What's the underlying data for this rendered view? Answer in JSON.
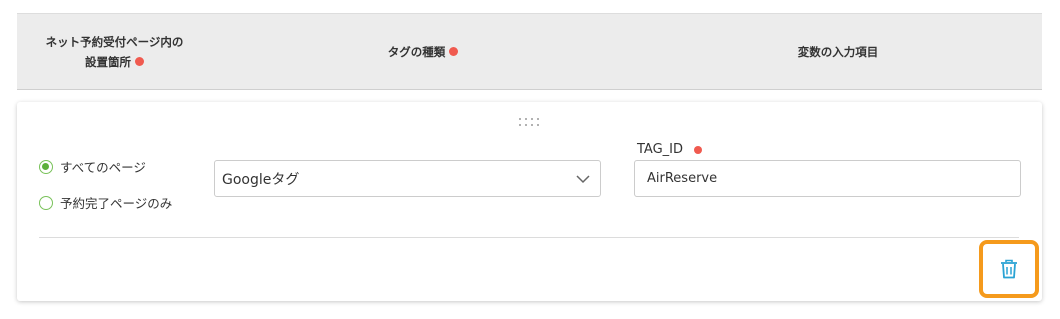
{
  "table_header": {
    "col1_line1": "ネット予約受付ページ内の",
    "col1_line2": "設置箇所",
    "col2": "タグの種類",
    "col3": "変数の入力項目"
  },
  "row": {
    "placement_options": [
      {
        "label": "すべてのページ",
        "checked": true
      },
      {
        "label": "予約完了ページのみ",
        "checked": false
      }
    ],
    "tag_type": {
      "value": "Googleタグ"
    },
    "variable_field": {
      "label": "TAG_ID",
      "value": "AirReserve"
    }
  },
  "colors": {
    "required_dot": "#f05a4f",
    "radio_accent": "#5cb03b",
    "highlight": "#f59a1c",
    "trash_icon": "#2aa3d4"
  },
  "icons": {
    "drag": "drag-handle-icon",
    "dropdown": "chevron-down-icon",
    "delete": "trash-icon"
  }
}
